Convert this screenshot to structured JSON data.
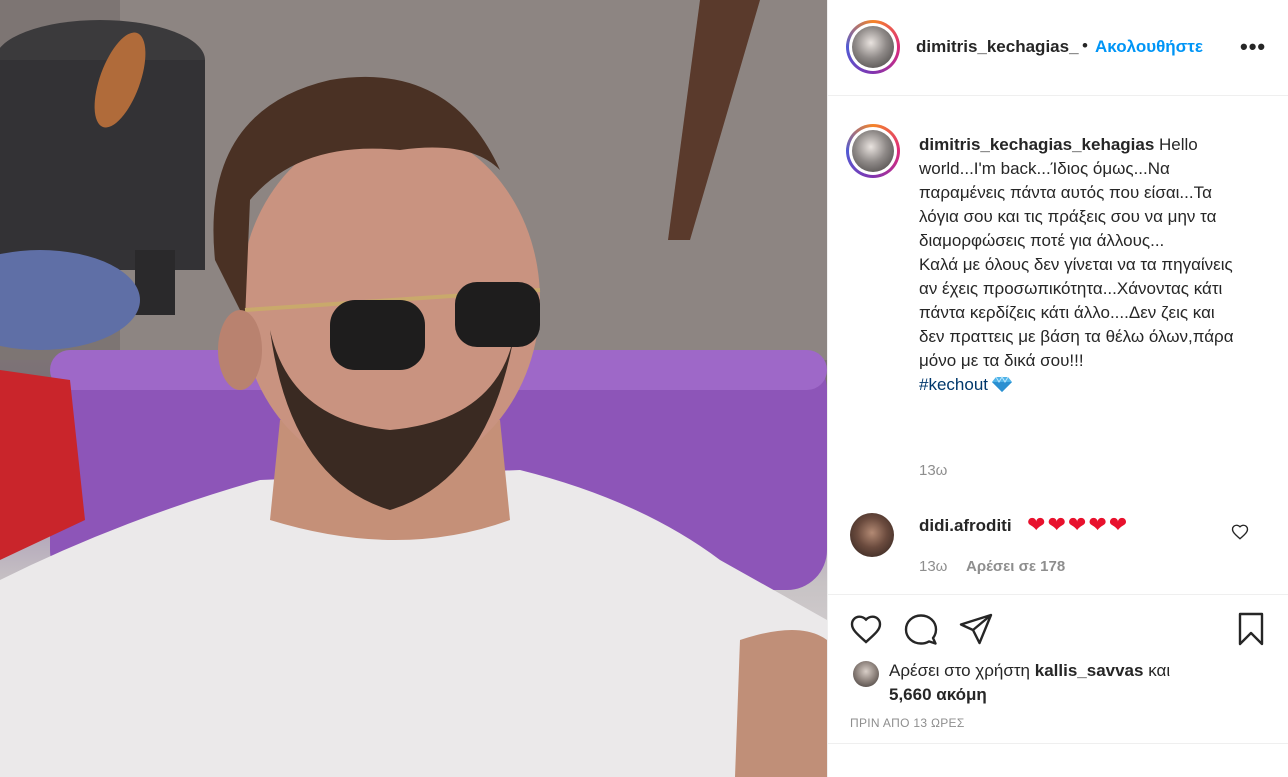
{
  "post": {
    "author_short": "dimitris_kechagias_",
    "dot": "•",
    "follow_label": "Ακολουθήστε",
    "more_label": "•••",
    "caption_user": "dimitris_kechagias_kehagias",
    "caption_text": " Hello world...I'm back...Ίδιος όμως...Να παραμένεις πάντα αυτός που είσαι...Τα λόγια σου και τις πράξεις σου να μην τα διαμορφώσεις ποτέ για άλλους...\nΚαλά με όλους δεν γίνεται να τα πηγαίνεις αν έχεις προσωπικότητα...Χάνοντας κάτι πάντα κερδίζεις κάτι άλλο....Δεν ζεις και δεν πραττεις με βάση τα θέλω όλων,πάρα μόνο με τα δικά σου!!!\n",
    "hashtag": "#kechout",
    "caption_time": "13ω"
  },
  "comment": {
    "user": "didi.afroditi",
    "hearts": [
      "❤",
      "❤",
      "❤",
      "❤",
      "❤"
    ],
    "time": "13ω",
    "likes": "Αρέσει σε 178"
  },
  "actions": {
    "icons": [
      "heart-icon",
      "comment-icon",
      "share-icon",
      "bookmark-icon"
    ]
  },
  "liked_by": {
    "prefix": "Αρέσει στο χρήστη ",
    "user": "kallis_savvas",
    "middle": " και ",
    "count": "5,660 ακόμη"
  },
  "posted_ago": "ΠΡΙΝ ΑΠΟ 13 ΩΡΕΣ",
  "colors": {
    "accent": "#0095f6",
    "hashtag": "#00376b",
    "muted": "#8e8e8e",
    "heart": "#e8112d"
  }
}
